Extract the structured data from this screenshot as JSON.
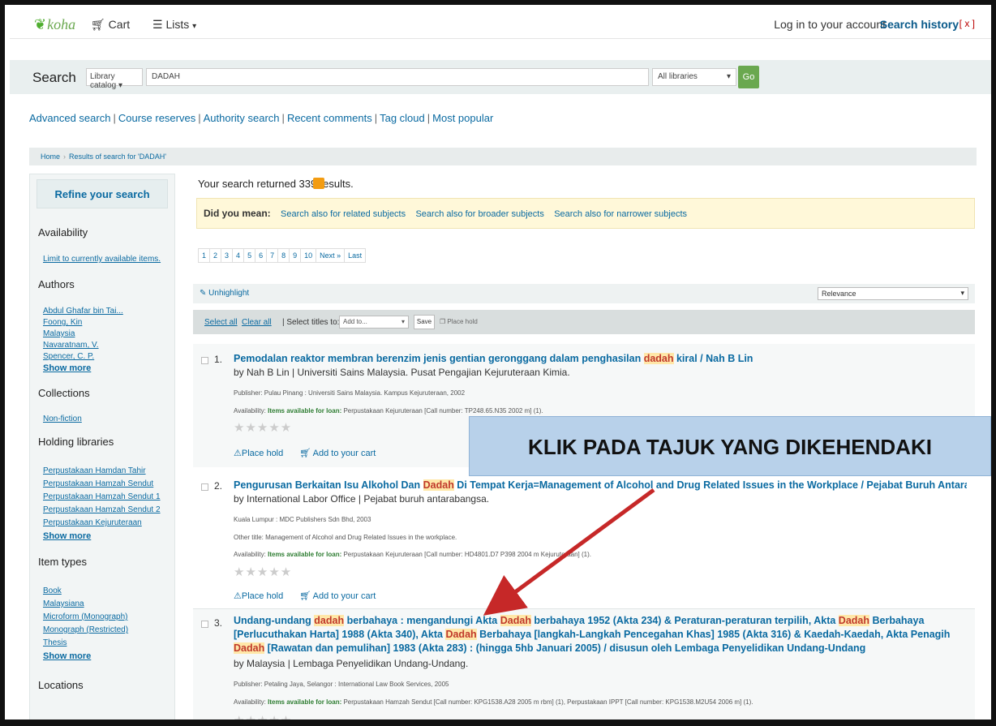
{
  "topbar": {
    "logo": "koha",
    "cart": "Cart",
    "lists": "Lists",
    "login": "Log in to your account",
    "search_history": "Search history",
    "search_history_close": "[ x ]"
  },
  "search": {
    "label": "Search",
    "catalog_select": "Library catalog",
    "query": "DADAH",
    "libraries_select": "All libraries",
    "go": "Go"
  },
  "more_search": {
    "advanced": "Advanced search",
    "course": "Course reserves",
    "authority": "Authority search",
    "recent": "Recent comments",
    "tagcloud": "Tag cloud",
    "popular": "Most popular"
  },
  "breadcrumb": {
    "home": "Home",
    "results": "Results of search for 'DADAH'"
  },
  "sidebar": {
    "refine": "Refine your search",
    "availability_head": "Availability",
    "availability_link": "Limit to currently available items.",
    "authors_head": "Authors",
    "authors": [
      "Abdul Ghafar bin Tai...",
      "Foong, Kin",
      "Malaysia",
      "Navaratnam, V.",
      "Spencer, C. P."
    ],
    "collections_head": "Collections",
    "collections": [
      "Non-fiction"
    ],
    "holding_head": "Holding libraries",
    "holding": [
      "Perpustakaan Hamdan Tahir",
      "Perpustakaan Hamzah Sendut",
      "Perpustakaan Hamzah Sendut 1",
      "Perpustakaan Hamzah Sendut 2",
      "Perpustakaan Kejuruteraan"
    ],
    "itemtypes_head": "Item types",
    "itemtypes": [
      "Book",
      "Malaysiana",
      "Microform (Monograph)",
      "Monograph (Restricted)",
      "Thesis"
    ],
    "show_more": "Show more",
    "locations_head": "Locations"
  },
  "main": {
    "results_count": "Your search returned 339 results.",
    "did_you_mean": "Did you mean:",
    "dym_related": "Search also for related subjects",
    "dym_broader": "Search also for broader subjects",
    "dym_narrower": "Search also for narrower subjects",
    "pages": [
      "1",
      "2",
      "3",
      "4",
      "5",
      "6",
      "7",
      "8",
      "9",
      "10",
      "Next »",
      "Last"
    ],
    "unhighlight": "Unhighlight",
    "sort": "Relevance",
    "select_all": "Select all",
    "clear_all": "Clear all",
    "select_titles": "| Select titles to:",
    "add_to": "Add to...",
    "save": "Save",
    "place_hold_top": "Place hold"
  },
  "results": [
    {
      "num": "1.",
      "title_pre": "Pemodalan reaktor membran berenzim jenis gentian geronggang dalam penghasilan ",
      "title_hl": "dadah",
      "title_post": " kiral / Nah B Lin",
      "byline": "by Nah B Lin | Universiti Sains Malaysia. Pusat Pengajian Kejuruteraan Kimia.",
      "publisher": "Publisher: Pulau Pinang : Universiti Sains Malaysia. Kampus Kejuruteraan, 2002",
      "availability_label": "Availability:",
      "availability_items": "Items available for loan:",
      "availability_rest": " Perpustakaan Kejuruteraan [Call number: TP248.65.N35 2002 m] (1).",
      "place_hold": "Place hold",
      "add_cart": "Add to your cart"
    },
    {
      "num": "2.",
      "title_pre": "Pengurusan Berkaitan Isu Alkohol Dan ",
      "title_hl": "Dadah",
      "title_post": " Di Tempat Kerja=Management of Alcohol and Drug Related Issues in the Workplace / Pejabat Buruh Antarabangsa",
      "byline": "by International Labor Office | Pejabat buruh antarabangsa.",
      "publisher": "Kuala Lumpur : MDC Publishers Sdn Bhd, 2003",
      "other_title": "Other title: Management of Alcohol and Drug Related Issues in the workplace.",
      "availability_label": "Availability:",
      "availability_items": "Items available for loan:",
      "availability_rest": " Perpustakaan Kejuruteraan [Call number: HD4801.D7 P398 2004 m Kejuruteraan] (1).",
      "place_hold": "Place hold",
      "add_cart": "Add to your cart"
    },
    {
      "num": "3.",
      "title_a": "Undang-undang ",
      "title_hl1": "dadah",
      "title_b": " berbahaya : mengandungi Akta ",
      "title_hl2": "Dadah",
      "title_c": " berbahaya 1952 (Akta 234) & Peraturan-peraturan terpilih, Akta ",
      "title_hl3": "Dadah",
      "title_d": " Berbahaya [Perlucuthakan Harta] 1988 (Akta 340), Akta ",
      "title_hl4": "Dadah",
      "title_e": " Berbahaya [langkah-Langkah Pencegahan Khas] 1985 (Akta 316) & Kaedah-Kaedah, Akta Penagih ",
      "title_hl5": "Dadah",
      "title_f": " [Rawatan dan pemulihan] 1983 (Akta 283) : (hingga 5hb Januari 2005) / disusun oleh Lembaga Penyelidikan Undang-Undang",
      "byline": "by Malaysia | Lembaga Penyelidikan Undang-Undang.",
      "publisher": "Publisher: Petaling Jaya, Selangor : International Law Book Services, 2005",
      "availability_label": "Availability:",
      "availability_items": "Items available for loan:",
      "availability_rest": " Perpustakaan Hamzah Sendut [Call number: KPG1538.A28 2005 m rbm] (1), Perpustakaan IPPT [Call number: KPG1538.M2U54 2006 m] (1)."
    }
  ],
  "callout": "KLIK PADA TAJUK YANG DIKEHENDAKI",
  "colors": {
    "link": "#0a6aa1",
    "go": "#6aa84f",
    "callout": "#b8d1ea",
    "arrow": "#c62828",
    "highlight": "#ffe7a8"
  }
}
